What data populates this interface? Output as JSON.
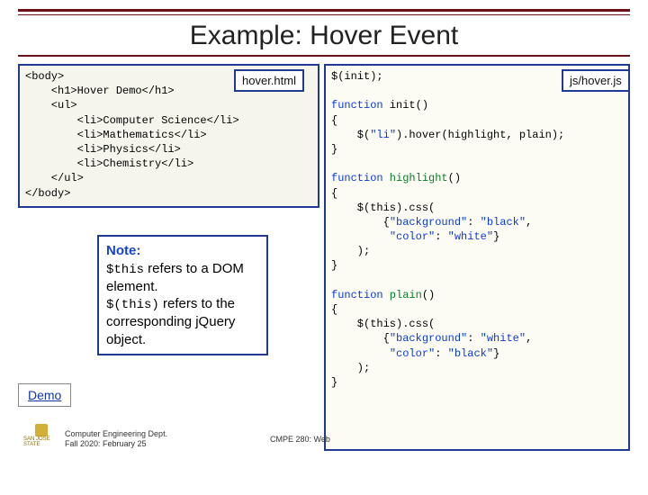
{
  "title": "Example: Hover Event",
  "html_file_label": "hover.html",
  "js_file_label": "js/hover.js",
  "html_code": "<body>\n    <h1>Hover Demo</h1>\n    <ul>\n        <li>Computer Science</li>\n        <li>Mathematics</li>\n        <li>Physics</li>\n        <li>Chemistry</li>\n    </ul>\n</body>",
  "js_code_pre1": "$(init);\n\n",
  "js_code_fn1a": "function",
  "js_code_fn1b": " init()\n{\n    $(",
  "js_code_str1": "\"li\"",
  "js_code_fn1c": ").hover(highlight, plain);\n}\n\n",
  "js_code_fn2a": "function",
  "js_code_fn2name": " highlight",
  "js_code_fn2b": "()\n{\n    $(this).css(\n        {",
  "js_code_bg": "\"background\"",
  "js_code_sep": ": ",
  "js_code_blk": "\"black\"",
  "js_code_comma": ",\n         ",
  "js_code_col": "\"color\"",
  "js_code_wht": "\"white\"",
  "js_code_fn2c": "}\n    );\n}\n\n",
  "js_code_fn3a": "function",
  "js_code_fn3name": " plain",
  "js_code_fn3b": "()\n{\n    $(this).css(\n        {",
  "js_code_fn3c": "}\n    );\n}",
  "note_header": "Note:",
  "note_body1": "$this",
  "note_body2": " refers to a DOM element.",
  "note_body3": "$(this)",
  "note_body4": " refers to the corresponding jQuery object.",
  "demo_label": "Demo",
  "footer_left_l1": "Computer Engineering Dept.",
  "footer_left_l2": "Fall 2020: February 25",
  "footer_center": "CMPE 280: Web",
  "logo_text": "SAN JOSE STATE"
}
